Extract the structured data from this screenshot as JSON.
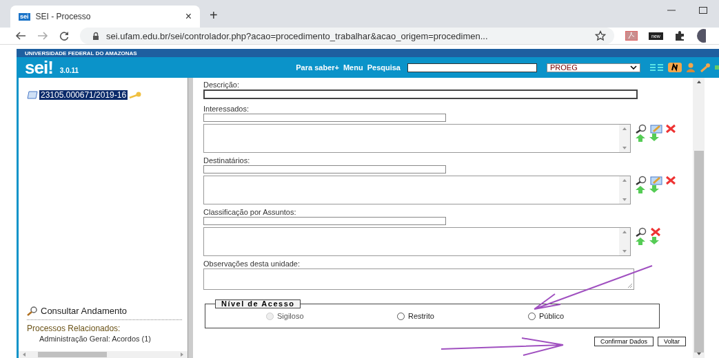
{
  "browser": {
    "tab": {
      "favicon_text": "sei",
      "title": "SEI - Processo",
      "close": "×"
    },
    "new_tab": "+",
    "url": "sei.ufam.edu.br/sei/controlador.php?acao=procedimento_trabalhar&acao_origem=procedimen...",
    "extension_label": "new"
  },
  "header": {
    "institution": "UNIVERSIDADE FEDERAL DO AMAZONAS",
    "logo": "sei!",
    "version": "3.0.11",
    "links": [
      "Para saber+",
      "Menu",
      "Pesquisa"
    ],
    "unit": "PROEG"
  },
  "tree": {
    "process": {
      "number": "23105.000671/2019-16",
      "selected": true
    },
    "consult": "Consultar Andamento",
    "related_title": "Processos Relacionados:",
    "related": [
      "Administração Geral: Acordos (1)"
    ]
  },
  "form": {
    "fields": [
      {
        "kind": "text",
        "label": "Descrição:"
      },
      {
        "kind": "selection",
        "label": "Interessados:"
      },
      {
        "kind": "selection",
        "label": "Destinatários:"
      },
      {
        "kind": "subject_selection",
        "label": "Classificação por Assuntos:"
      },
      {
        "kind": "textarea",
        "label": "Observações desta unidade:"
      }
    ],
    "access": {
      "legend": "Nível de Acesso",
      "options": [
        {
          "label": "Sigiloso",
          "selected": false,
          "disabled": true
        },
        {
          "label": "Restrito",
          "selected": false,
          "disabled": false
        },
        {
          "label": "Público",
          "selected": false,
          "disabled": false
        }
      ]
    },
    "buttons": [
      "Confirmar Dados",
      "Voltar"
    ]
  }
}
